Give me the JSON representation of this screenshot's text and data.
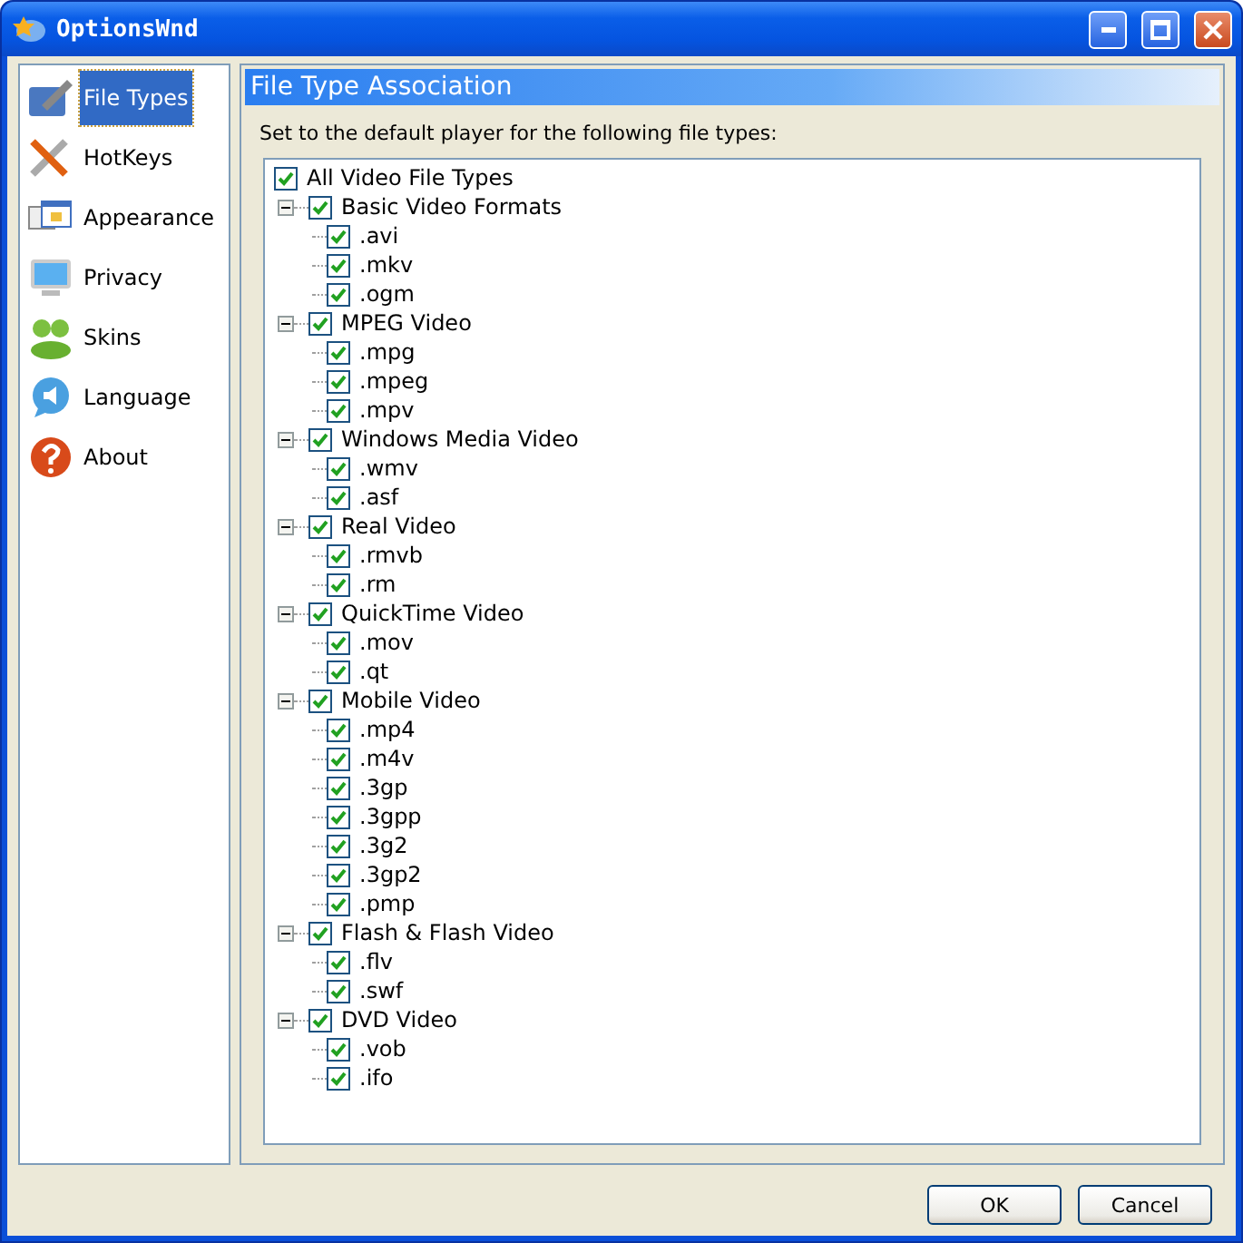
{
  "window": {
    "title": "OptionsWnd"
  },
  "sidebar": {
    "items": [
      {
        "label": "File Types",
        "selected": true
      },
      {
        "label": "HotKeys",
        "selected": false
      },
      {
        "label": "Appearance",
        "selected": false
      },
      {
        "label": "Privacy",
        "selected": false
      },
      {
        "label": "Skins",
        "selected": false
      },
      {
        "label": "Language",
        "selected": false
      },
      {
        "label": "About",
        "selected": false
      }
    ]
  },
  "panel": {
    "title": "File Type Association",
    "description": "Set to the default player for the following file types:"
  },
  "tree": {
    "label": "All Video File Types",
    "checked": true,
    "children": [
      {
        "label": "Basic Video Formats",
        "checked": true,
        "expanded": true,
        "children": [
          {
            "label": ".avi",
            "checked": true
          },
          {
            "label": ".mkv",
            "checked": true
          },
          {
            "label": ".ogm",
            "checked": true
          }
        ]
      },
      {
        "label": "MPEG Video",
        "checked": true,
        "expanded": true,
        "children": [
          {
            "label": ".mpg",
            "checked": true
          },
          {
            "label": ".mpeg",
            "checked": true
          },
          {
            "label": ".mpv",
            "checked": true
          }
        ]
      },
      {
        "label": "Windows Media Video",
        "checked": true,
        "expanded": true,
        "children": [
          {
            "label": ".wmv",
            "checked": true
          },
          {
            "label": ".asf",
            "checked": true
          }
        ]
      },
      {
        "label": "Real Video",
        "checked": true,
        "expanded": true,
        "children": [
          {
            "label": ".rmvb",
            "checked": true
          },
          {
            "label": ".rm",
            "checked": true
          }
        ]
      },
      {
        "label": "QuickTime Video",
        "checked": true,
        "expanded": true,
        "children": [
          {
            "label": ".mov",
            "checked": true
          },
          {
            "label": ".qt",
            "checked": true
          }
        ]
      },
      {
        "label": "Mobile Video",
        "checked": true,
        "expanded": true,
        "children": [
          {
            "label": ".mp4",
            "checked": true
          },
          {
            "label": ".m4v",
            "checked": true
          },
          {
            "label": ".3gp",
            "checked": true
          },
          {
            "label": ".3gpp",
            "checked": true
          },
          {
            "label": ".3g2",
            "checked": true
          },
          {
            "label": ".3gp2",
            "checked": true
          },
          {
            "label": ".pmp",
            "checked": true
          }
        ]
      },
      {
        "label": "Flash & Flash Video",
        "checked": true,
        "expanded": true,
        "children": [
          {
            "label": ".flv",
            "checked": true
          },
          {
            "label": ".swf",
            "checked": true
          }
        ]
      },
      {
        "label": "DVD Video",
        "checked": true,
        "expanded": true,
        "children": [
          {
            "label": ".vob",
            "checked": true
          },
          {
            "label": ".ifo",
            "checked": true
          }
        ]
      }
    ]
  },
  "buttons": [
    "OK",
    "Cancel"
  ]
}
